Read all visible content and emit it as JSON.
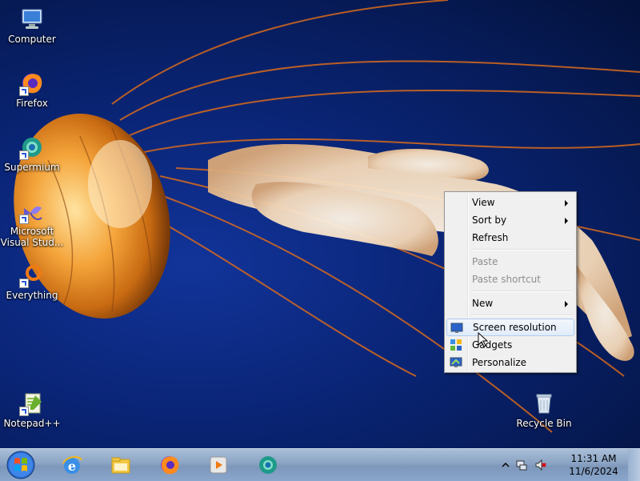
{
  "desktop": {
    "icons": [
      {
        "label": "Computer",
        "icon": "computer-icon"
      },
      {
        "label": "Firefox",
        "icon": "firefox-icon"
      },
      {
        "label": "Supermium",
        "icon": "supermium-icon"
      },
      {
        "label": "Microsoft\nVisual Stud...",
        "icon": "visual-studio-icon"
      },
      {
        "label": "Everything",
        "icon": "everything-icon"
      },
      {
        "label": "Notepad++",
        "icon": "notepadpp-icon"
      },
      {
        "label": "Recycle Bin",
        "icon": "recycle-bin-icon"
      }
    ]
  },
  "context_menu": {
    "items": [
      {
        "label": "View",
        "submenu": true,
        "enabled": true
      },
      {
        "label": "Sort by",
        "submenu": true,
        "enabled": true
      },
      {
        "label": "Refresh",
        "enabled": true
      },
      {
        "label": "Paste",
        "enabled": false
      },
      {
        "label": "Paste shortcut",
        "enabled": false
      },
      {
        "label": "New",
        "submenu": true,
        "enabled": true
      },
      {
        "label": "Screen resolution",
        "enabled": true,
        "icon": "screen-resolution-icon",
        "highlighted": true
      },
      {
        "label": "Gadgets",
        "enabled": true,
        "icon": "gadgets-icon"
      },
      {
        "label": "Personalize",
        "enabled": true,
        "icon": "personalize-icon"
      }
    ]
  },
  "taskbar": {
    "pinned": [
      "internet-explorer-icon",
      "file-explorer-icon",
      "firefox-icon",
      "media-player-icon",
      "supermium-icon"
    ],
    "clock": {
      "time": "11:31 AM",
      "date": "11/6/2024"
    }
  },
  "colors": {
    "accent": "#1e4fd6",
    "menu_highlight": "#e1ecf9",
    "taskbar": "#8ba4c4"
  }
}
